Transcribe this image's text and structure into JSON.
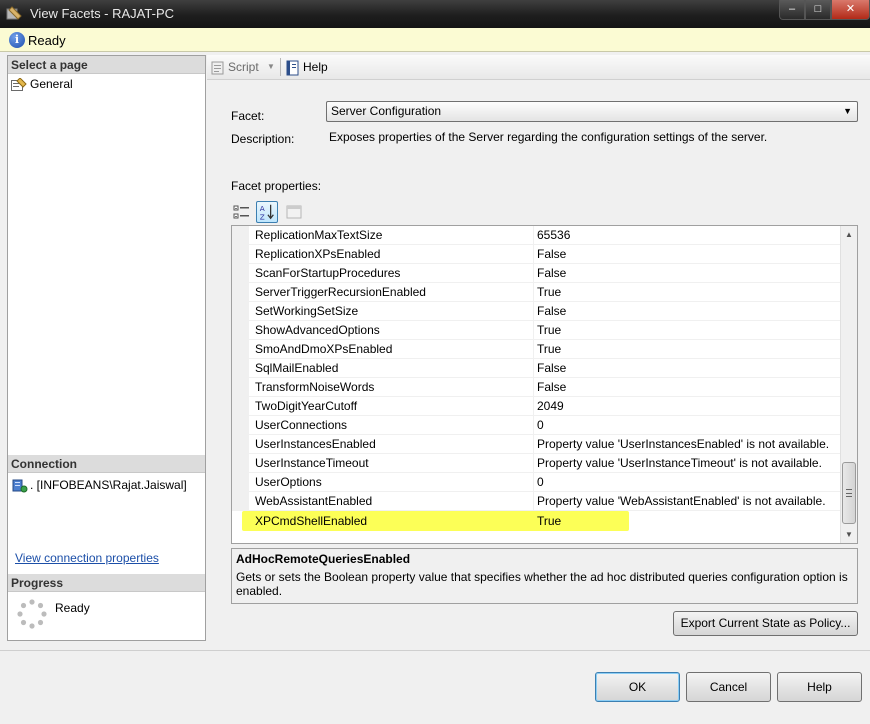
{
  "window": {
    "title": "View Facets - RAJAT-PC",
    "controls": {
      "minimize": "–",
      "maximize": "□",
      "close": "✕"
    }
  },
  "status": {
    "text": "Ready"
  },
  "left_pane": {
    "select_page_header": "Select a page",
    "pages": [
      {
        "label": "General"
      }
    ],
    "connection_header": "Connection",
    "connection_item": ". [INFOBEANS\\Rajat.Jaiswal]",
    "view_connection_link": "View connection properties",
    "progress_header": "Progress",
    "progress_text": "Ready"
  },
  "toolbar": {
    "script_label": "Script",
    "script_arrow": "▼",
    "help_label": "Help"
  },
  "facet": {
    "facet_label": "Facet:",
    "selected": "Server Configuration",
    "dropdown_arrow": "▼",
    "description_label": "Description:",
    "description": "Exposes properties of the Server regarding the configuration settings of the server.",
    "properties_label": "Facet properties:"
  },
  "properties": [
    {
      "name": "ReplicationMaxTextSize",
      "value": "65536"
    },
    {
      "name": "ReplicationXPsEnabled",
      "value": "False"
    },
    {
      "name": "ScanForStartupProcedures",
      "value": "False"
    },
    {
      "name": "ServerTriggerRecursionEnabled",
      "value": "True"
    },
    {
      "name": "SetWorkingSetSize",
      "value": "False"
    },
    {
      "name": "ShowAdvancedOptions",
      "value": "True"
    },
    {
      "name": "SmoAndDmoXPsEnabled",
      "value": "True"
    },
    {
      "name": "SqlMailEnabled",
      "value": "False"
    },
    {
      "name": "TransformNoiseWords",
      "value": "False"
    },
    {
      "name": "TwoDigitYearCutoff",
      "value": "2049"
    },
    {
      "name": "UserConnections",
      "value": "0"
    },
    {
      "name": "UserInstancesEnabled",
      "value": "Property value 'UserInstancesEnabled' is not available."
    },
    {
      "name": "UserInstanceTimeout",
      "value": "Property value 'UserInstanceTimeout' is not available."
    },
    {
      "name": "UserOptions",
      "value": "0"
    },
    {
      "name": "WebAssistantEnabled",
      "value": "Property value 'WebAssistantEnabled' is not available."
    }
  ],
  "highlighted_property": {
    "name": "XPCmdShellEnabled",
    "value": "True",
    "highlight_color": "#fbff3a"
  },
  "scrollbar": {
    "up": "▲",
    "down": "▼"
  },
  "description_panel": {
    "title": "AdHocRemoteQueriesEnabled",
    "text": "Gets or sets the Boolean property value that specifies whether the ad hoc distributed queries configuration option is enabled."
  },
  "buttons": {
    "export": "Export Current State as Policy...",
    "ok": "OK",
    "cancel": "Cancel",
    "help": "Help"
  },
  "colors": {
    "link": "#1c4fa8",
    "status_bg": "#fbfbd3"
  }
}
